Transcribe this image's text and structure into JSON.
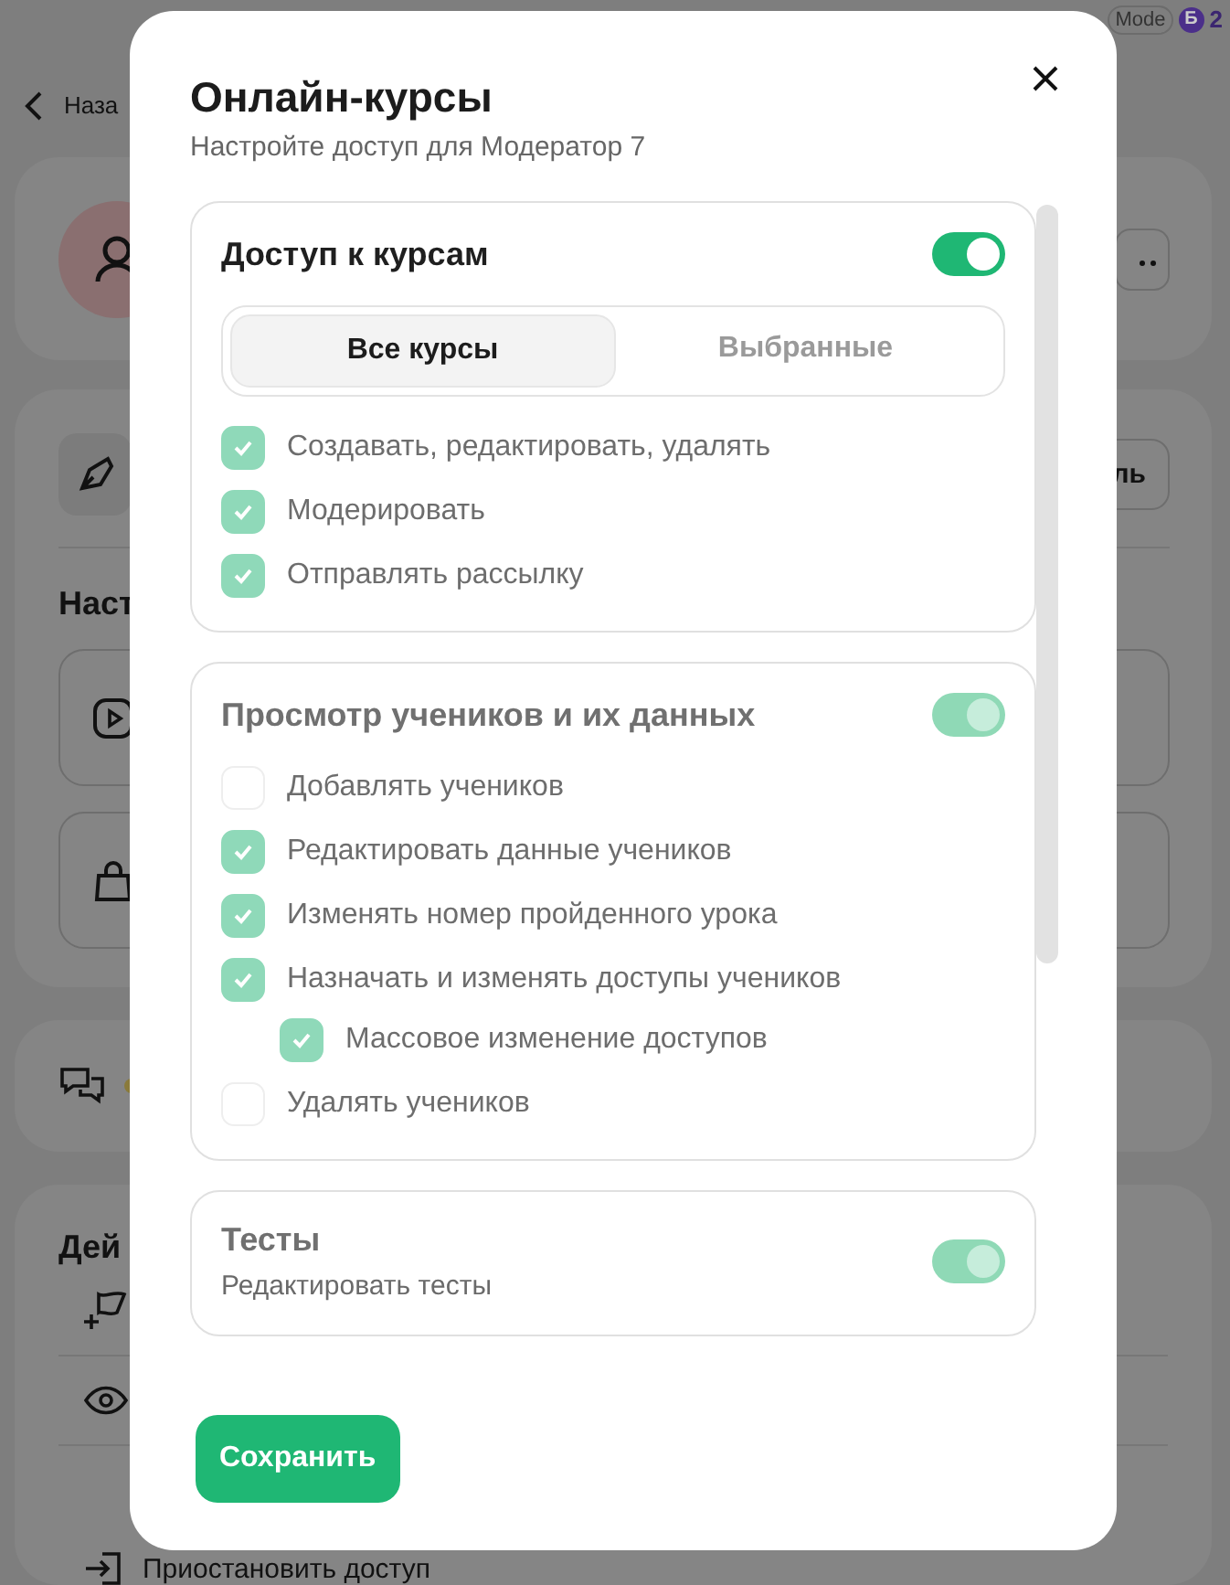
{
  "background": {
    "top_bar": {
      "mode_label": "Mode",
      "badge_letter": "Б",
      "badge_count": "2"
    },
    "back_link": "Наза",
    "settings_card": {
      "button": "ль",
      "heading": "Наст"
    },
    "actions_card": {
      "heading": "Дей",
      "last_action": "Приостановить доступ"
    }
  },
  "modal": {
    "title": "Онлайн-курсы",
    "subtitle": "Настройте доступ для Модератор 7",
    "sections": [
      {
        "title": "Доступ к курсам",
        "on": true,
        "disabled": false,
        "tabs": [
          {
            "label": "Все курсы",
            "selected": true
          },
          {
            "label": "Выбранные",
            "selected": false
          }
        ],
        "items": [
          {
            "label": "Создавать, редактировать, удалять",
            "checked": true
          },
          {
            "label": "Модерировать",
            "checked": true
          },
          {
            "label": "Отправлять рассылку",
            "checked": true
          }
        ]
      },
      {
        "title": "Просмотр учеников и их данных",
        "on": true,
        "disabled": true,
        "items": [
          {
            "label": "Добавлять учеников",
            "checked": false
          },
          {
            "label": "Редактировать данные учеников",
            "checked": true
          },
          {
            "label": "Изменять номер пройденного урока",
            "checked": true
          },
          {
            "label": "Назначать и изменять доступы учеников",
            "checked": true,
            "children": [
              {
                "label": "Массовое изменение доступов",
                "checked": true
              }
            ]
          },
          {
            "label": "Удалять учеников",
            "checked": false
          }
        ]
      },
      {
        "title": "Тесты",
        "subtitle": "Редактировать тесты",
        "on": true,
        "disabled": true
      }
    ],
    "save_button": "Сохранить"
  }
}
